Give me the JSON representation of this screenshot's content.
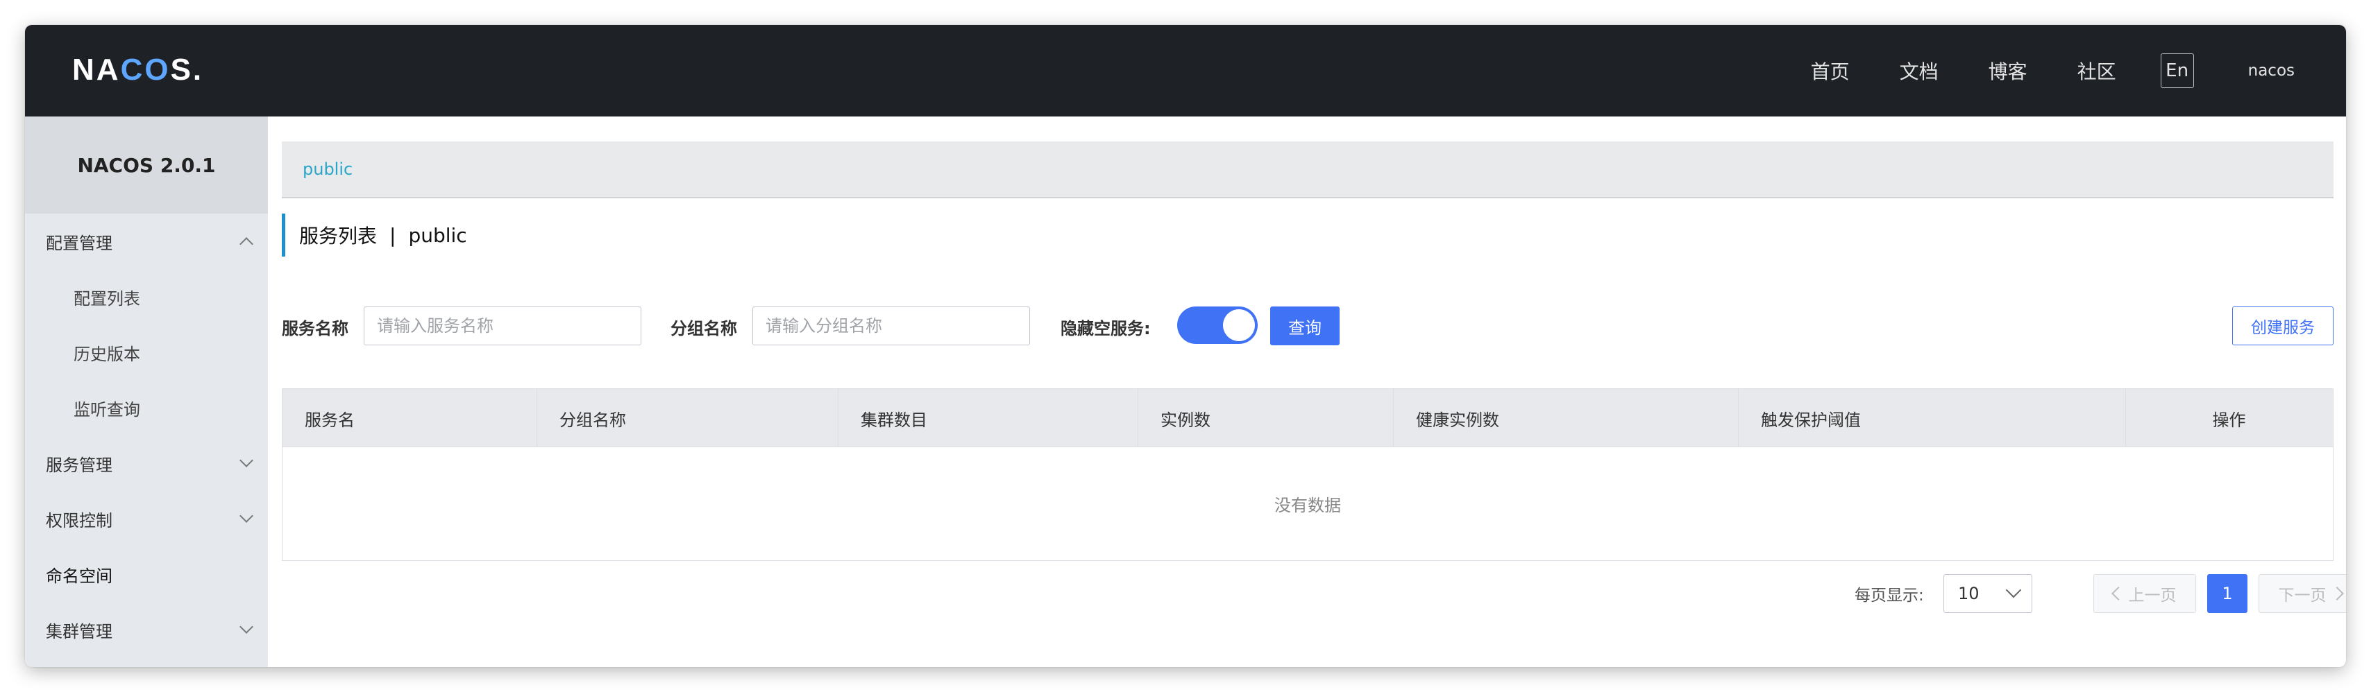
{
  "header": {
    "logo": "NACOS.",
    "nav": [
      "首页",
      "文档",
      "博客",
      "社区"
    ],
    "lang": "En",
    "user": "nacos"
  },
  "sidebar": {
    "title": "NACOS 2.0.1",
    "items": [
      {
        "label": "配置管理",
        "expanded": true
      },
      {
        "label": "配置列表"
      },
      {
        "label": "历史版本"
      },
      {
        "label": "监听查询"
      },
      {
        "label": "服务管理",
        "expanded": false
      },
      {
        "label": "权限控制",
        "expanded": false
      },
      {
        "label": "命名空间"
      },
      {
        "label": "集群管理",
        "expanded": false
      }
    ]
  },
  "namespace": {
    "current": "public"
  },
  "page": {
    "title": "服务列表",
    "separator": "|",
    "namespace": "public"
  },
  "filter": {
    "service_name_label": "服务名称",
    "service_name_placeholder": "请输入服务名称",
    "group_name_label": "分组名称",
    "group_name_placeholder": "请输入分组名称",
    "hide_empty_label": "隐藏空服务:",
    "hide_empty_on": true,
    "query_button": "查询",
    "create_button": "创建服务"
  },
  "table": {
    "columns": [
      "服务名",
      "分组名称",
      "集群数目",
      "实例数",
      "健康实例数",
      "触发保护阈值",
      "操作"
    ],
    "empty_text": "没有数据"
  },
  "pagination": {
    "per_page_label": "每页显示:",
    "per_page_value": "10",
    "prev": "上一页",
    "next": "下一页",
    "current_page": "1"
  },
  "colors": {
    "accent": "#3f72f5",
    "header_bg": "#1e2126",
    "sidebar_bg": "#e5e8ec",
    "link": "#2aa5c9"
  }
}
